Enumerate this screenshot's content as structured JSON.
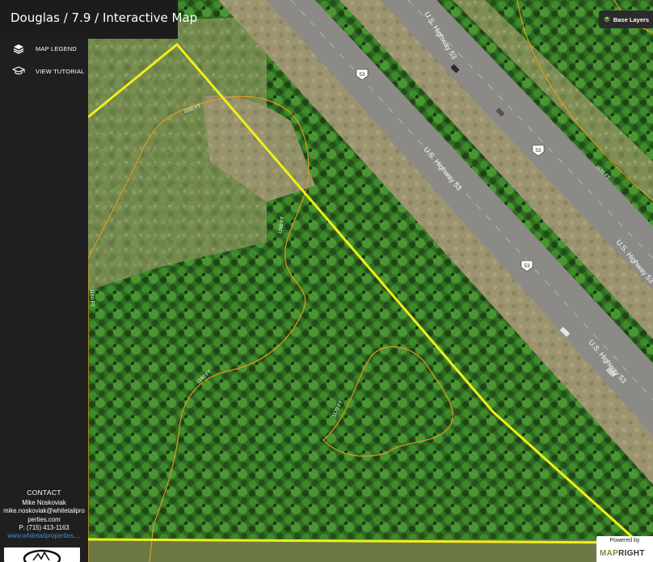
{
  "header": {
    "title": "Douglas / 7.9 / Interactive Map"
  },
  "sidebar": {
    "menu": [
      {
        "label": "MAP LEGEND",
        "icon": "layers-icon"
      },
      {
        "label": "VIEW TUTORIAL",
        "icon": "graduation-cap-icon"
      }
    ],
    "contact": {
      "heading": "CONTACT",
      "name": "Mike Noskoviak",
      "email": "mike.noskoviak@whitetailproperties.com",
      "phone": "P: (715) 413-1163",
      "website": "www.whitetailproperties...."
    }
  },
  "controls": {
    "base_layers_label": "Base Layers",
    "base_layers_icon": "layers-icon"
  },
  "attribution": {
    "powered_by": "Powered by",
    "brand_part1": "MAP",
    "brand_part2": "RIGHT"
  },
  "map": {
    "highway_labels": [
      "U.S. Highway 53",
      "U.S. Highway 53",
      "U.S. Highway 53",
      "U.S. Highway 53"
    ],
    "shields": [
      "53",
      "53",
      "53"
    ],
    "contour_labels": [
      "1160 FT",
      "1160 FT",
      "1160 FT",
      "1170 FT",
      "1170 FT",
      "1160 FT"
    ],
    "colors": {
      "boundary": "#f2ee1a",
      "contour": "#e39a1c",
      "forest": "#2f6e22",
      "road": "#8c8a86"
    }
  }
}
